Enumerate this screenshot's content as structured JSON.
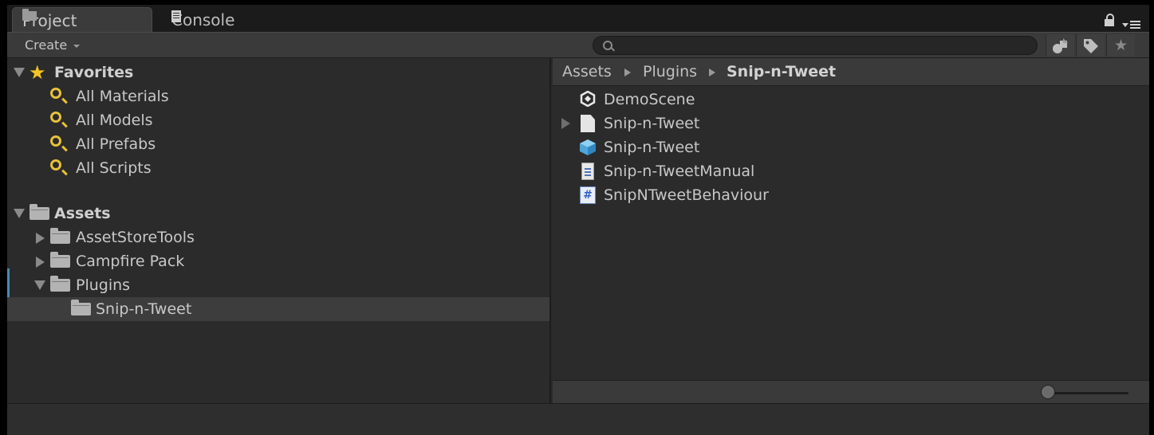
{
  "tabs": [
    {
      "label": "Project",
      "icon": "folder-icon",
      "active": true
    },
    {
      "label": "Console",
      "icon": "console-icon",
      "active": false
    }
  ],
  "tab_icons": {
    "lock": "lock-icon",
    "menu": "menu-icon"
  },
  "toolbar": {
    "create_label": "Create",
    "search_placeholder": "",
    "search_value": "",
    "filter_buttons": [
      "search-by-type-icon",
      "search-by-label-icon",
      "favorites-star-icon"
    ]
  },
  "favorites": {
    "header": "Favorites",
    "items": [
      {
        "label": "All Materials"
      },
      {
        "label": "All Models"
      },
      {
        "label": "All Prefabs"
      },
      {
        "label": "All Scripts"
      }
    ]
  },
  "assets": {
    "header": "Assets",
    "items": [
      {
        "label": "AssetStoreTools",
        "expanded": false
      },
      {
        "label": "Campfire Pack",
        "expanded": false
      },
      {
        "label": "Plugins",
        "expanded": true
      },
      {
        "label": "Snip-n-Tweet",
        "selected": true
      }
    ]
  },
  "breadcrumb": [
    "Assets",
    "Plugins",
    "Snip-n-Tweet"
  ],
  "files": [
    {
      "label": "DemoScene",
      "icon": "unity-scene-icon"
    },
    {
      "label": "Snip-n-Tweet",
      "icon": "document-icon",
      "expandable": true
    },
    {
      "label": "Snip-n-Tweet",
      "icon": "prefab-cube-icon"
    },
    {
      "label": "Snip-n-TweetManual",
      "icon": "manual-document-icon"
    },
    {
      "label": "SnipNTweetBehaviour",
      "icon": "csharp-script-icon"
    }
  ],
  "colors": {
    "accent_yellow": "#f5c623",
    "selection": "#3d3d3d",
    "panel": "#2b2b2b"
  }
}
